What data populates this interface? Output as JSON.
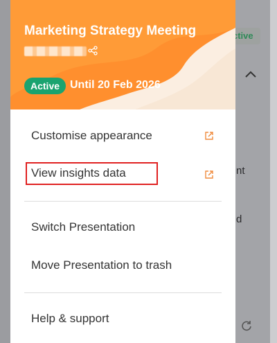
{
  "meeting": {
    "title": "Marketing Strategy Meeting",
    "status": "Active",
    "until": "Until 20 Feb 2026"
  },
  "menu": {
    "items": [
      {
        "label": "Customise appearance",
        "external": true
      },
      {
        "label": "View insights data",
        "external": true
      },
      {
        "label": "Switch Presentation",
        "external": false
      },
      {
        "label": "Move Presentation to trash",
        "external": false
      },
      {
        "label": "Help & support",
        "external": false
      }
    ]
  },
  "background": {
    "badge": "ctive",
    "text1": "nt",
    "text2": "d"
  },
  "colors": {
    "header_orange": "#ff8f2e",
    "status_green": "#1aa36f",
    "external_icon": "#f08a3c",
    "highlight_red": "#e02020"
  },
  "icons": {
    "share": "share-icon",
    "external": "external-link-icon",
    "chevron": "chevron-up-icon",
    "refresh": "refresh-icon"
  }
}
